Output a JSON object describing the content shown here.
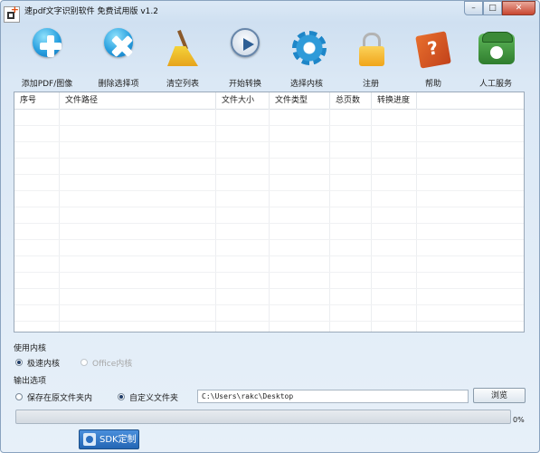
{
  "window": {
    "title": "速pdf文字识别软件 免费试用版 v1.2",
    "controls": {
      "minimize": "–",
      "maximize": "□",
      "close": "✕"
    }
  },
  "toolbar": {
    "items": [
      {
        "label": "添加PDF/图像",
        "icon": "add-icon"
      },
      {
        "label": "删除选择项",
        "icon": "delete-icon"
      },
      {
        "label": "清空列表",
        "icon": "broom-icon"
      },
      {
        "label": "开始转换",
        "icon": "play-icon"
      },
      {
        "label": "选择内核",
        "icon": "gear-icon"
      },
      {
        "label": "注册",
        "icon": "lock-icon"
      },
      {
        "label": "帮助",
        "icon": "help-book-icon"
      },
      {
        "label": "人工服务",
        "icon": "phone-icon"
      }
    ]
  },
  "table": {
    "columns": [
      "序号",
      "文件路径",
      "文件大小",
      "文件类型",
      "总页数",
      "转换进度"
    ],
    "rows": []
  },
  "engine": {
    "heading": "使用内核",
    "options": [
      {
        "label": "极速内核",
        "selected": true,
        "enabled": true
      },
      {
        "label": "Office内核",
        "selected": false,
        "enabled": false
      }
    ]
  },
  "output": {
    "heading": "输出选项",
    "options": [
      {
        "label": "保存在原文件夹内",
        "selected": false
      },
      {
        "label": "自定义文件夹",
        "selected": true
      }
    ],
    "path": "C:\\Users\\rakc\\Desktop",
    "browse_label": "浏览"
  },
  "progress": {
    "value": 0,
    "text": "0%"
  },
  "sdk_button": {
    "label": "SDK定制"
  },
  "colors": {
    "accent": "#2aa1e0",
    "progress": "#39b54a",
    "sdk": "#2366b4"
  }
}
